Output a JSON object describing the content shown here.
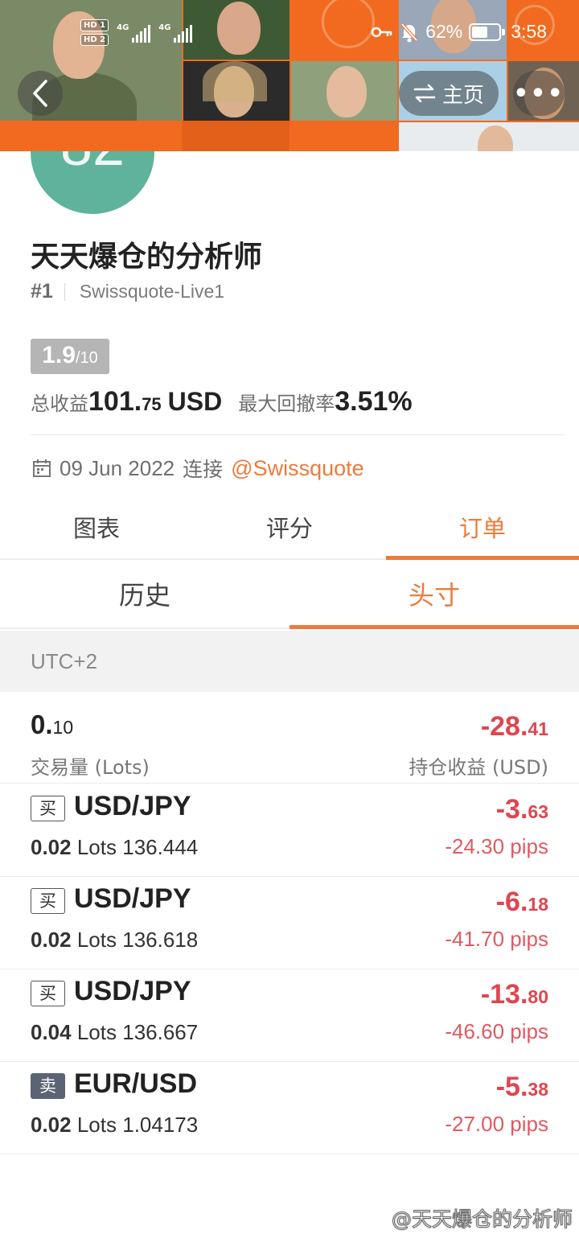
{
  "status_bar": {
    "hd1": "HD 1",
    "hd2": "HD 2",
    "net1": "4G",
    "net2": "4G",
    "battery_percent": "62%",
    "battery_level": 0.62,
    "time": "3:58"
  },
  "header": {
    "home_label": "主页"
  },
  "profile": {
    "avatar_number": "82",
    "name": "天天爆仓的分析师",
    "rank": "#1",
    "broker": "Swissquote-Live1",
    "score_main": "1.9",
    "score_total": "/10",
    "total_profit_label": "总收益",
    "total_profit_int": "101.",
    "total_profit_dec": "75",
    "total_profit_unit": "USD",
    "max_drawdown_label": "最大回撤率",
    "max_drawdown_value": "3.51%",
    "connect_date": "09 Jun 2022",
    "connect_label": "连接",
    "connect_link": "@Swissquote"
  },
  "tabs_main": [
    {
      "label": "图表",
      "active": false
    },
    {
      "label": "评分",
      "active": false
    },
    {
      "label": "订单",
      "active": true
    }
  ],
  "tabs_sub": [
    {
      "label": "历史",
      "active": false
    },
    {
      "label": "头寸",
      "active": true
    }
  ],
  "timezone": "UTC+2",
  "summary": {
    "volume_int": "0.",
    "volume_dec": "10",
    "volume_label": "交易量 (Lots)",
    "pnl_int": "-28.",
    "pnl_dec": "41",
    "pnl_label": "持仓收益 (USD)"
  },
  "orders": [
    {
      "side": "买",
      "pair": "USD/JPY",
      "lots": "0.02",
      "lots_unit": "Lots",
      "price": "136.444",
      "profit_int": "-3.",
      "profit_dec": "63",
      "pips": "-24.30 pips"
    },
    {
      "side": "买",
      "pair": "USD/JPY",
      "lots": "0.02",
      "lots_unit": "Lots",
      "price": "136.618",
      "profit_int": "-6.",
      "profit_dec": "18",
      "pips": "-41.70 pips"
    },
    {
      "side": "买",
      "pair": "USD/JPY",
      "lots": "0.04",
      "lots_unit": "Lots",
      "price": "136.667",
      "profit_int": "-13.",
      "profit_dec": "80",
      "pips": "-46.60 pips"
    },
    {
      "side": "卖",
      "pair": "EUR/USD",
      "lots": "0.02",
      "lots_unit": "Lots",
      "price": "1.04173",
      "profit_int": "-5.",
      "profit_dec": "38",
      "pips": "-27.00 pips"
    }
  ],
  "watermark": "@天天爆仓的分析师",
  "colors": {
    "accent": "#ee7a3b",
    "negative": "#e0454f",
    "banner": "#f26a1f",
    "avatar": "#5fb39d"
  }
}
